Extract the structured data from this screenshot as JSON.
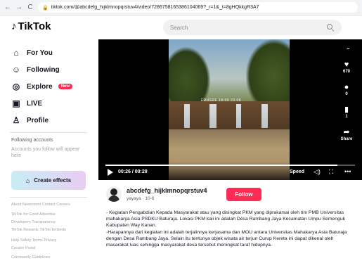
{
  "browser": {
    "url": "tiktok.com/@abcdefg_hijklmnopqrstuv4/video/7286758165386104069?_r=1&_t=8gHQkkgR3A7"
  },
  "header": {
    "logo_text": "TikTok",
    "search_placeholder": "Search"
  },
  "sidebar": {
    "nav": [
      {
        "label": "For You",
        "icon": "home-icon"
      },
      {
        "label": "Following",
        "icon": "users-icon"
      },
      {
        "label": "Explore",
        "icon": "compass-icon",
        "badge": "New"
      },
      {
        "label": "LIVE",
        "icon": "live-icon"
      },
      {
        "label": "Profile",
        "icon": "profile-icon"
      }
    ],
    "following_title": "Following accounts",
    "following_desc": "Accounts you follow will appear here",
    "create_effects": "Create effects",
    "footer": [
      "About Newsroom Contact Careers",
      "TikTok for Good Advertise",
      "Developers Transparency",
      "TikTok Rewards TikTok Embeds",
      "Help Safety Terms Privacy",
      "Creator Portal",
      "Community Guidelines"
    ]
  },
  "video": {
    "watermark": "FRUSRF 18:00 23.06",
    "likes": "670",
    "comments": "0",
    "saves": "1",
    "share_label": "Share",
    "time": "00:26 / 00:28",
    "progress": 0.93,
    "speed_label": "Speed"
  },
  "creator": {
    "username": "abcdefg_hijklmnopqrstuv4",
    "subline": "yayaya · 10-6",
    "follow_label": "Follow"
  },
  "description": [
    "- Kegiatan Pengabdian Kepada Masyarakat atau yang disingkat PKM yang diprakarsai oleh tim PMB Universitas mahakarya Asia PSDKU Baturaja. Lokasi PKM kali ini adalah Desa Rambang Jaya Kecamatan Umpu Semenguk Kabupaten Way Kanan.",
    "-Harapannya dari kegiatan ini adalah terjalinnya kerjasama dan MOU antara Universitas Mahakarya Asia Baturaja dengan Desa Rambang Jaya. Selain itu tentunya objek wisata air terjun Curup Kereta ini dapat dikenal oleh masarakat luas sehingga masyarakat desa tersebut meningkat taraf hidupnya."
  ],
  "colors": {
    "brand_red": "#fe2c55",
    "text_primary": "#161823"
  }
}
